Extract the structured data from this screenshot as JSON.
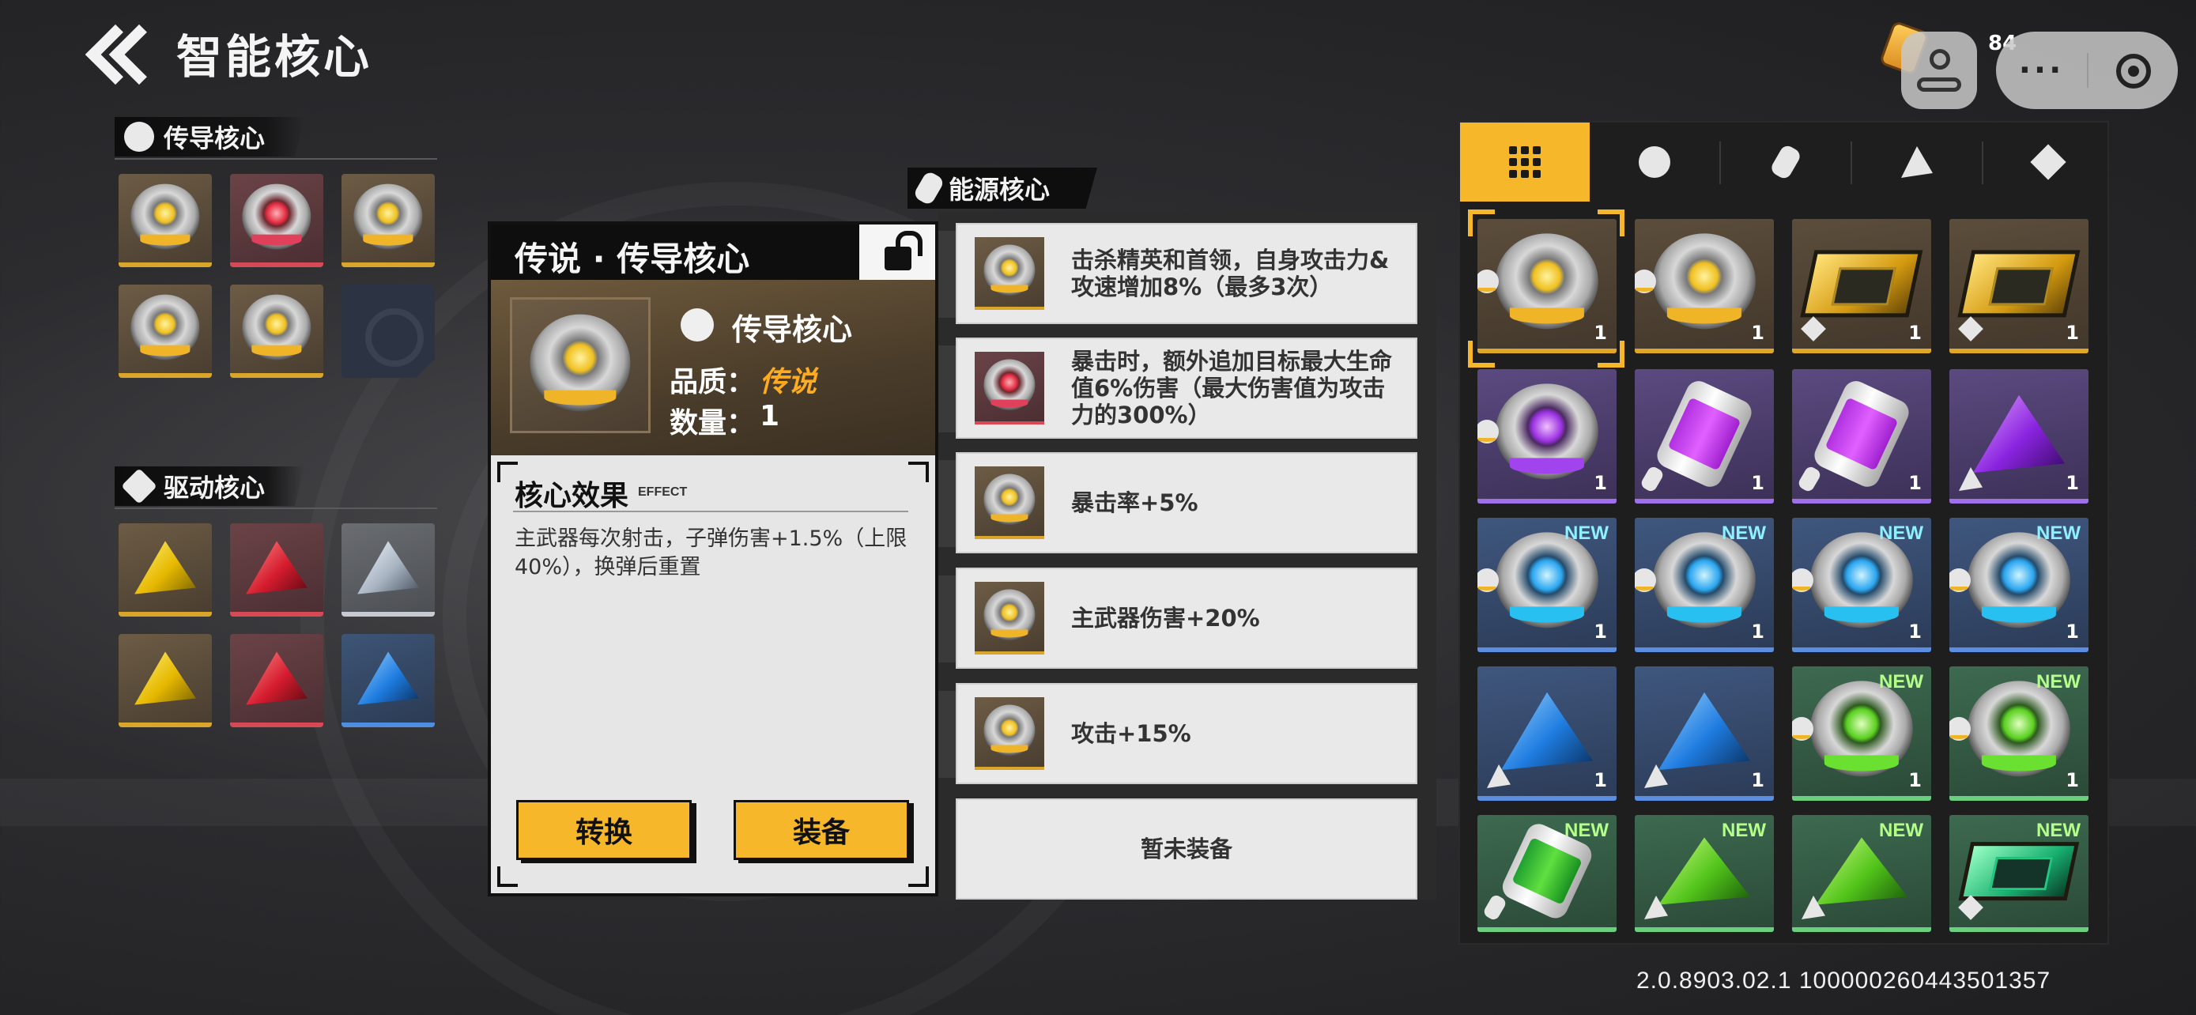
{
  "header": {
    "title": "智能核心"
  },
  "currency": {
    "value": "84"
  },
  "mini_program": {
    "more_label": "···"
  },
  "conduct_section": {
    "title": "传导核心",
    "slots": [
      {
        "kind": "orb",
        "rarity": "gold"
      },
      {
        "kind": "orb",
        "rarity": "red"
      },
      {
        "kind": "orb",
        "rarity": "gold"
      },
      {
        "kind": "orb",
        "rarity": "gold"
      },
      {
        "kind": "orb",
        "rarity": "gold"
      },
      {
        "kind": "empty",
        "rarity": "empty"
      }
    ]
  },
  "drive_section": {
    "title": "驱动核心",
    "slots": [
      {
        "kind": "prism",
        "rarity": "gold"
      },
      {
        "kind": "prism",
        "rarity": "red"
      },
      {
        "kind": "prism",
        "rarity": "silver"
      },
      {
        "kind": "prism",
        "rarity": "gold"
      },
      {
        "kind": "prism",
        "rarity": "red"
      },
      {
        "kind": "prism",
        "rarity": "blue"
      }
    ]
  },
  "card": {
    "title": "传说 · 传导核心",
    "type_label": "传导核心",
    "quality_label": "品质：",
    "quality_value": "传说",
    "count_label": "数量：",
    "count_value": "1",
    "effect_title": "核心效果",
    "effect_sub": "EFFECT",
    "effect_text": "主武器每次射击，子弹伤害+1.5%（上限40%），换弹后重置",
    "convert_label": "转换",
    "equip_label": "装备"
  },
  "energy_section": {
    "title": "能源核心",
    "rows": [
      {
        "text": "击杀精英和首领，自身攻击力&攻速增加8%（最多3次）",
        "rarity": "gold"
      },
      {
        "text": "暴击时，额外追加目标最大生命值6%伤害（最大伤害值为攻击力的300%）",
        "rarity": "red"
      },
      {
        "text": "暴击率+5%",
        "rarity": "gold"
      },
      {
        "text": "主武器伤害+20%",
        "rarity": "gold"
      },
      {
        "text": "攻击+15%",
        "rarity": "gold"
      }
    ],
    "empty_label": "暂未装备"
  },
  "inventory": {
    "tabs": [
      "all-grid-icon",
      "conduct-core-icon",
      "energy-core-icon",
      "drive-core-icon",
      "chip-core-icon"
    ],
    "items": [
      {
        "kind": "orb",
        "color": "gold",
        "rarity": "gold",
        "type": "orb",
        "count": "1",
        "new": "",
        "selected": true
      },
      {
        "kind": "orb",
        "color": "gold",
        "rarity": "gold",
        "type": "orb",
        "count": "1",
        "new": ""
      },
      {
        "kind": "chip",
        "color": "gold",
        "rarity": "gold",
        "type": "chp",
        "count": "1",
        "new": ""
      },
      {
        "kind": "chip",
        "color": "gold",
        "rarity": "gold",
        "type": "chp",
        "count": "1",
        "new": ""
      },
      {
        "kind": "orb",
        "color": "purple",
        "rarity": "purple",
        "type": "orb",
        "count": "1",
        "new": ""
      },
      {
        "kind": "cell",
        "color": "purple",
        "rarity": "purple",
        "type": "bat",
        "count": "1",
        "new": ""
      },
      {
        "kind": "cell",
        "color": "purple",
        "rarity": "purple",
        "type": "bat",
        "count": "1",
        "new": ""
      },
      {
        "kind": "prism",
        "color": "purple",
        "rarity": "purple",
        "type": "gem",
        "count": "1",
        "new": ""
      },
      {
        "kind": "orb",
        "color": "cyan",
        "rarity": "blue",
        "type": "orb",
        "count": "1",
        "new": "NEW"
      },
      {
        "kind": "orb",
        "color": "cyan",
        "rarity": "blue",
        "type": "orb",
        "count": "1",
        "new": "NEW"
      },
      {
        "kind": "orb",
        "color": "cyan",
        "rarity": "blue",
        "type": "orb",
        "count": "1",
        "new": "NEW"
      },
      {
        "kind": "orb",
        "color": "cyan",
        "rarity": "blue",
        "type": "orb",
        "count": "1",
        "new": "NEW"
      },
      {
        "kind": "prism",
        "color": "blue",
        "rarity": "blue",
        "type": "gem",
        "count": "1",
        "new": ""
      },
      {
        "kind": "prism",
        "color": "blue",
        "rarity": "blue",
        "type": "gem",
        "count": "1",
        "new": ""
      },
      {
        "kind": "orb",
        "color": "green",
        "rarity": "green",
        "type": "orb",
        "count": "1",
        "new": "NEW"
      },
      {
        "kind": "orb",
        "color": "green",
        "rarity": "green",
        "type": "orb",
        "count": "1",
        "new": "NEW"
      },
      {
        "kind": "cell",
        "color": "green",
        "rarity": "green",
        "type": "bat",
        "count": "",
        "new": "NEW"
      },
      {
        "kind": "prism",
        "color": "green",
        "rarity": "green",
        "type": "gem",
        "count": "",
        "new": "NEW"
      },
      {
        "kind": "prism",
        "color": "green",
        "rarity": "green",
        "type": "gem",
        "count": "",
        "new": "NEW"
      },
      {
        "kind": "chip",
        "color": "green",
        "rarity": "green",
        "type": "chp",
        "count": "",
        "new": "NEW"
      }
    ]
  },
  "footer": {
    "version": "2.0.8903.02.1 100000260443501357"
  }
}
